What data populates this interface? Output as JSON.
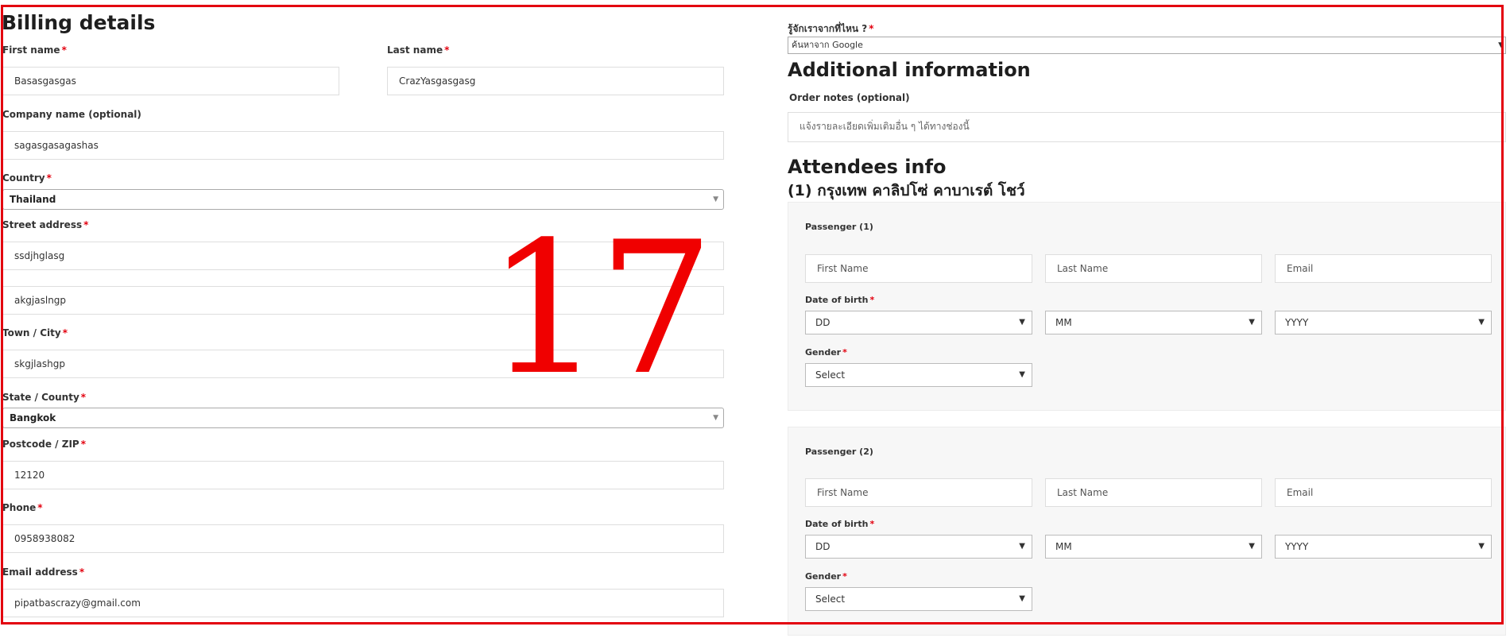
{
  "billing": {
    "title": "Billing details",
    "first_name_label": "First name",
    "first_name_value": "Basasgasgas",
    "last_name_label": "Last name",
    "last_name_value": "CrazYasgasgasg",
    "company_label": "Company name (optional)",
    "company_value": "sagasgasagashas",
    "country_label": "Country",
    "country_value": "Thailand",
    "street_label": "Street address",
    "street1_value": "ssdjhglasg",
    "street2_value": "akgjaslngp",
    "city_label": "Town / City",
    "city_value": "skgjlashgp",
    "state_label": "State / County",
    "state_value": "Bangkok",
    "postcode_label": "Postcode / ZIP",
    "postcode_value": "12120",
    "phone_label": "Phone",
    "phone_value": "0958938082",
    "email_label": "Email address",
    "email_value": "pipatbascrazy@gmail.com",
    "required_mark": "*"
  },
  "source": {
    "label": "รู้จักเราจากที่ไหน ?",
    "value": "ค้นหาจาก Google"
  },
  "additional": {
    "title": "Additional information",
    "notes_label": "Order notes (optional)",
    "notes_placeholder": "แจ้งรายละเอียดเพิ่มเติมอื่น ๆ ได้ทางช่องนี้"
  },
  "attendees": {
    "title": "Attendees info",
    "event_title": "(1) กรุงเทพ คาลิปโซ่ คาบาเรต์ โชว์",
    "passengers": [
      {
        "heading": "Passenger (1)",
        "first_name_ph": "First Name",
        "last_name_ph": "Last Name",
        "email_ph": "Email",
        "dob_label": "Date of birth",
        "dd": "DD",
        "mm": "MM",
        "yyyy": "YYYY",
        "gender_label": "Gender",
        "gender_value": "Select"
      },
      {
        "heading": "Passenger (2)",
        "first_name_ph": "First Name",
        "last_name_ph": "Last Name",
        "email_ph": "Email",
        "dob_label": "Date of birth",
        "dd": "DD",
        "mm": "MM",
        "yyyy": "YYYY",
        "gender_label": "Gender",
        "gender_value": "Select"
      }
    ]
  },
  "overlay_number": "17",
  "colors": {
    "frame": "#e3000f",
    "required": "#e3000f",
    "overlay": "#f00000"
  },
  "icons": {
    "select_caret": "caret-down-icon"
  }
}
